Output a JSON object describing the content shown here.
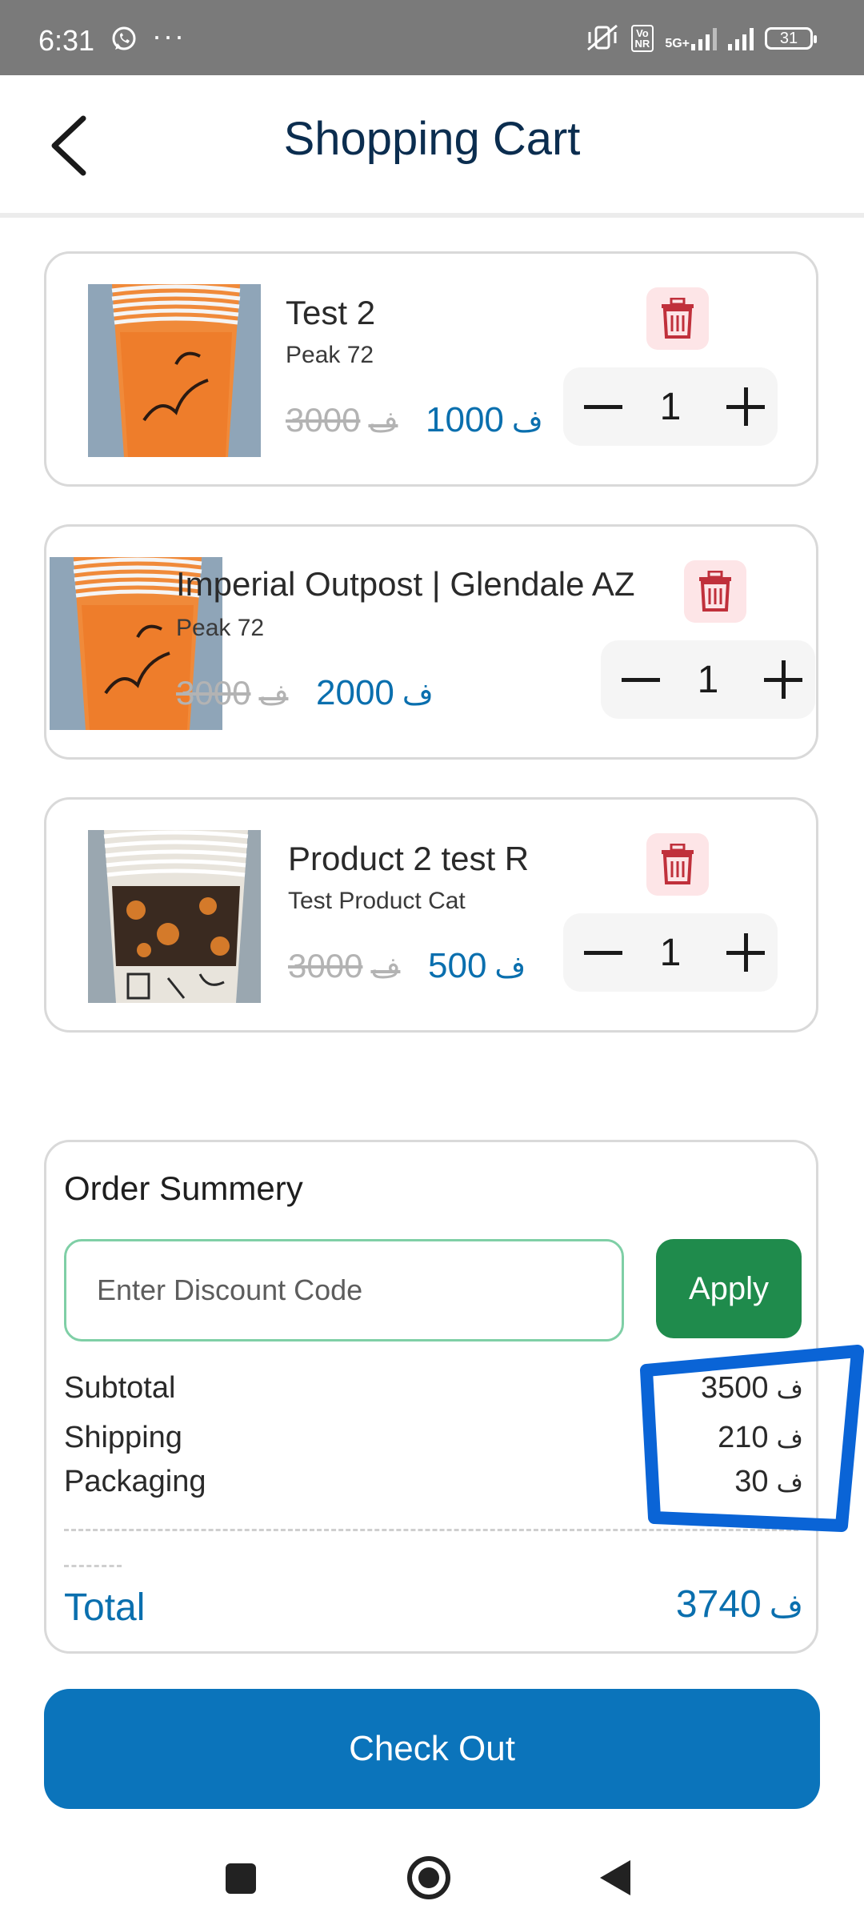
{
  "status_bar": {
    "time": "6:31",
    "dots": "···",
    "volte_badge": "Vo\nNR",
    "net_label": "5G+",
    "battery": "31"
  },
  "header": {
    "title": "Shopping Cart",
    "back_icon": "chevron-left-icon"
  },
  "colors": {
    "title": "#0b2d4f",
    "price": "#0a6fae",
    "apply": "#1f8b4c",
    "checkout": "#0b74bb",
    "delete_bg": "#fde5e7",
    "delete_icon": "#c0303b",
    "annotation": "#0a64d6"
  },
  "cart": {
    "items": [
      {
        "name": "Test 2",
        "category": "Peak 72",
        "old_price": "3000",
        "price": "1000",
        "currency": "ﻑ",
        "quantity": "1",
        "image": "orange-cup-stack"
      },
      {
        "name": "Imperial Outpost | Glendale AZ",
        "category": "Peak 72",
        "old_price": "3000",
        "price": "2000",
        "currency": "ﻑ",
        "quantity": "1",
        "image": "orange-cup-stack"
      },
      {
        "name": "Product 2 test R",
        "category": "Test Product Cat",
        "old_price": "3000",
        "price": "500",
        "currency": "ﻑ",
        "quantity": "1",
        "image": "patterned-cup-stack"
      }
    ]
  },
  "summary": {
    "title": "Order Summery",
    "discount_placeholder": "Enter Discount Code",
    "discount_value": "",
    "apply_label": "Apply",
    "rows": [
      {
        "label": "Subtotal",
        "value": "3500"
      },
      {
        "label": "Shipping",
        "value": "210"
      },
      {
        "label": "Packaging",
        "value": "30"
      }
    ],
    "total_label": "Total",
    "total_value": "3740",
    "currency": "ﻑ"
  },
  "checkout_label": "Check Out",
  "nav": {
    "icons": [
      "square-icon",
      "home-circle-icon",
      "back-triangle-icon"
    ]
  }
}
